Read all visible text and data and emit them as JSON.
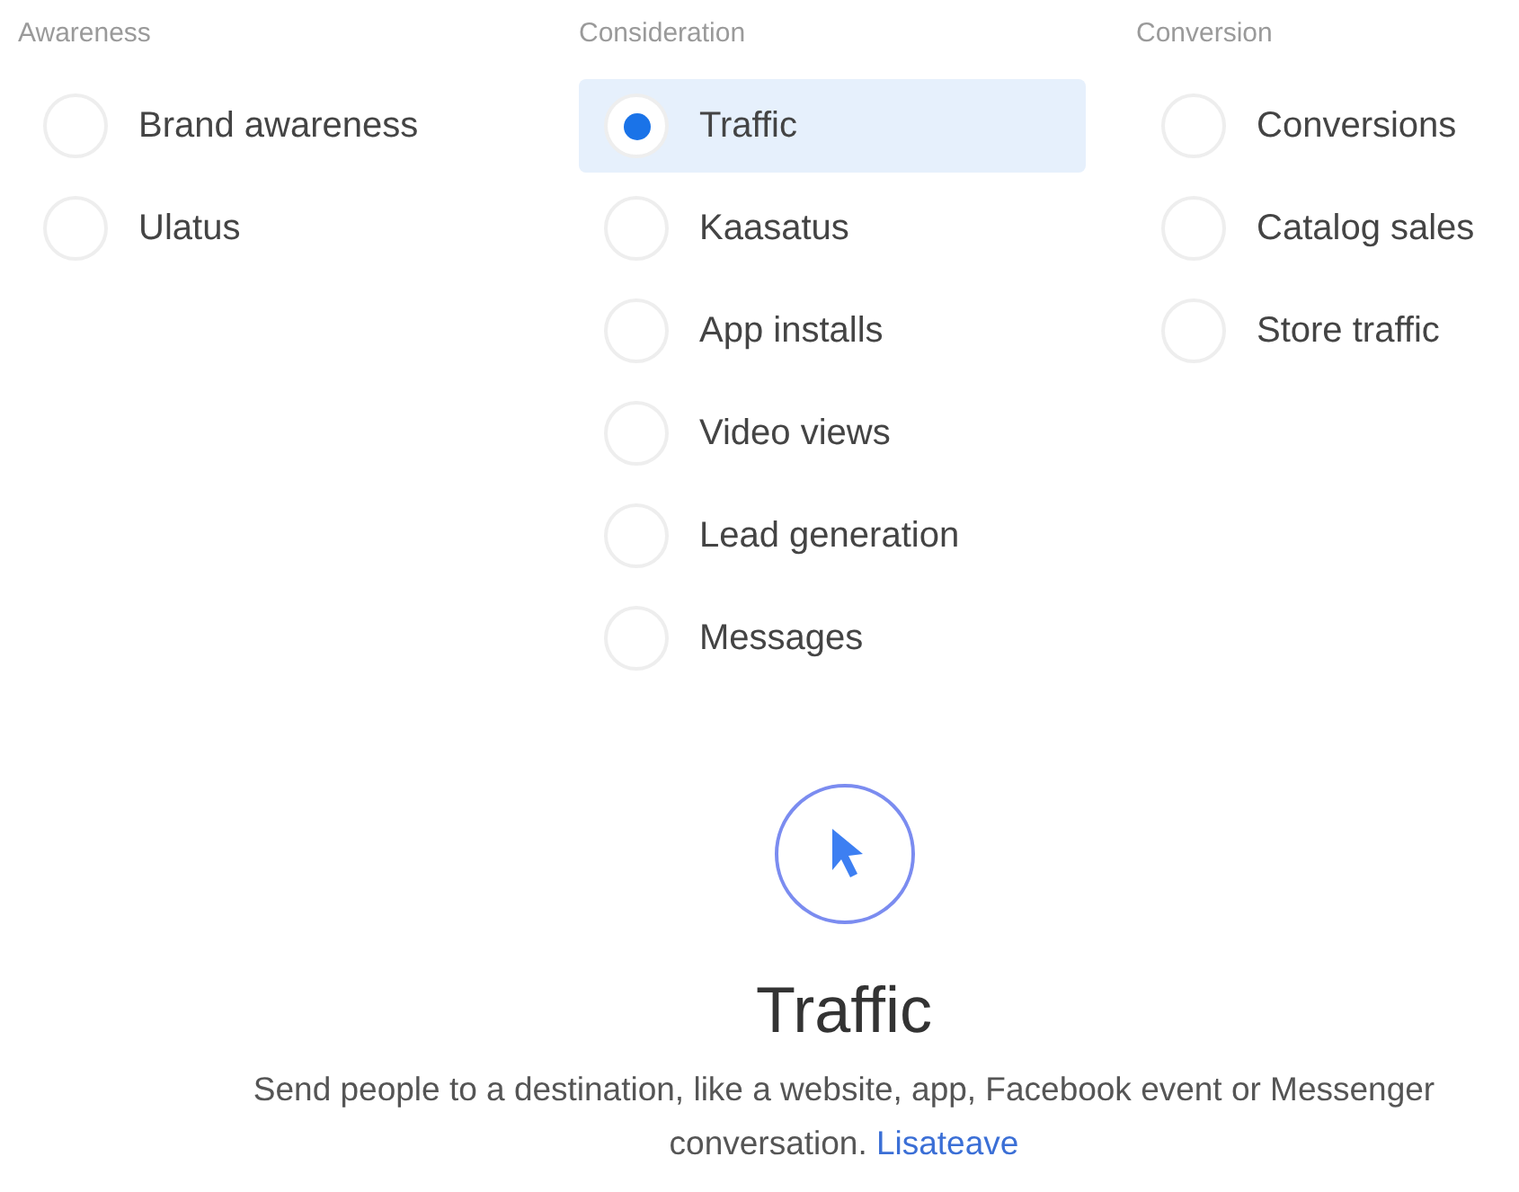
{
  "groups": [
    {
      "heading": "Awareness",
      "options": [
        {
          "label": "Brand awareness",
          "selected": false
        },
        {
          "label": "Ulatus",
          "selected": false
        }
      ]
    },
    {
      "heading": "Consideration",
      "options": [
        {
          "label": "Traffic",
          "selected": true
        },
        {
          "label": "Kaasatus",
          "selected": false
        },
        {
          "label": "App installs",
          "selected": false
        },
        {
          "label": "Video views",
          "selected": false
        },
        {
          "label": "Lead generation",
          "selected": false
        },
        {
          "label": "Messages",
          "selected": false
        }
      ]
    },
    {
      "heading": "Conversion",
      "options": [
        {
          "label": "Conversions",
          "selected": false
        },
        {
          "label": "Catalog sales",
          "selected": false
        },
        {
          "label": "Store traffic",
          "selected": false
        }
      ]
    }
  ],
  "detail": {
    "title": "Traffic",
    "description": "Send people to a destination, like a website, app, Facebook event or Messenger conversation.",
    "link": "Lisateave"
  }
}
